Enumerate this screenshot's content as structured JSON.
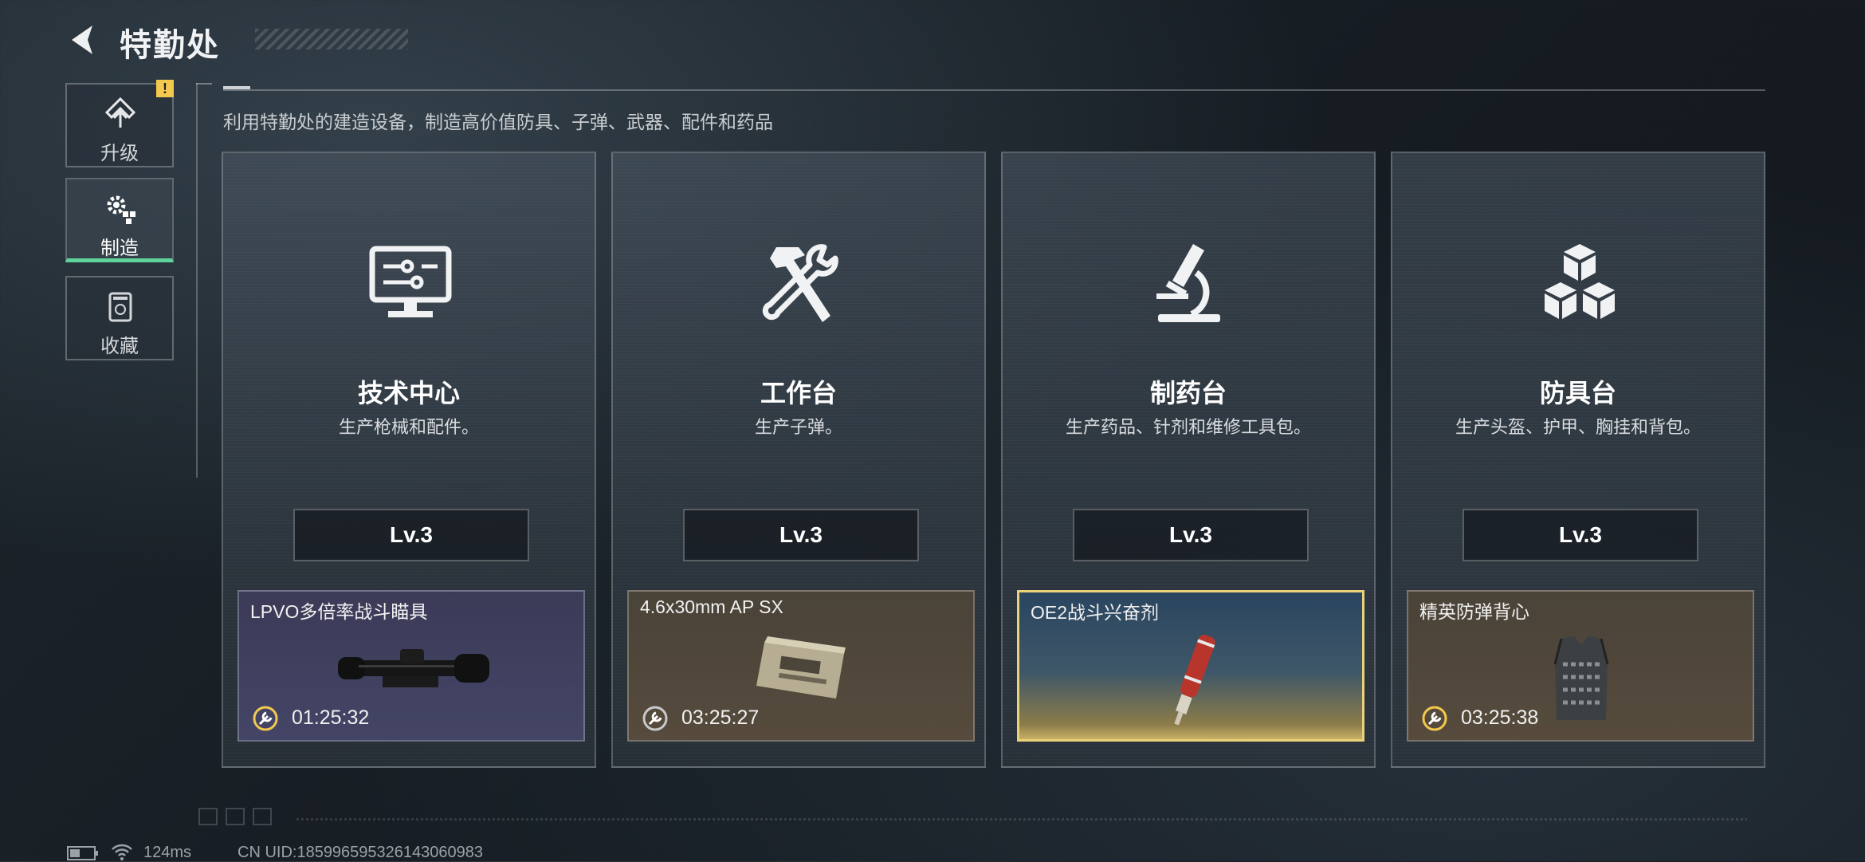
{
  "header": {
    "title": "特勤处"
  },
  "nav": [
    {
      "label": "升级",
      "icon": "upgrade-icon",
      "badge": "!"
    },
    {
      "label": "制造",
      "icon": "gears-icon",
      "active": true
    },
    {
      "label": "收藏",
      "icon": "collection-icon"
    }
  ],
  "subtitle": "利用特勤处的建造设备，制造高价值防具、子弹、武器、配件和药品",
  "stations": [
    {
      "name": "技术中心",
      "desc": "生产枪械和配件。",
      "level": "Lv.3",
      "icon": "monitor-circuit-icon",
      "item": {
        "name": "LPVO多倍率战斗瞄具",
        "time": "01:25:32",
        "tier": "purple",
        "image": "scope-image"
      }
    },
    {
      "name": "工作台",
      "desc": "生产子弹。",
      "level": "Lv.3",
      "icon": "hammer-wrench-icon",
      "item": {
        "name": "4.6x30mm AP SX",
        "time": "03:25:27",
        "tier": "brown",
        "image": "ammo-box-image"
      }
    },
    {
      "name": "制药台",
      "desc": "生产药品、针剂和维修工具包。",
      "level": "Lv.3",
      "icon": "microscope-icon",
      "item": {
        "name": "OE2战斗兴奋剂",
        "time": "",
        "tier": "gold",
        "image": "injector-image"
      }
    },
    {
      "name": "防具台",
      "desc": "生产头盔、护甲、胸挂和背包。",
      "level": "Lv.3",
      "icon": "cubes-icon",
      "item": {
        "name": "精英防弹背心",
        "time": "03:25:38",
        "tier": "brown",
        "image": "vest-image"
      }
    }
  ],
  "footer": {
    "ping": "124ms",
    "uid": "CN UID:1859965953261430609​83"
  }
}
